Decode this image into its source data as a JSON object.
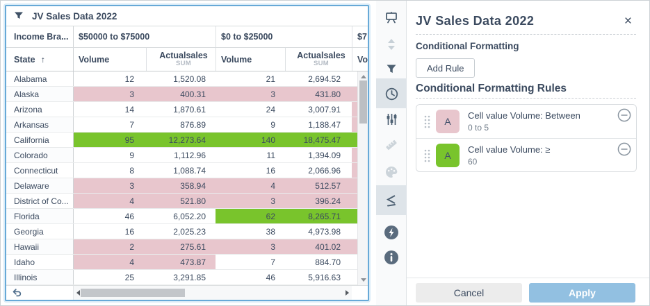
{
  "colors": {
    "green": "#79c42c",
    "pink": "#e8c6cd",
    "white": ""
  },
  "widget": {
    "title": "JV Sales Data 2022"
  },
  "table": {
    "corner_header": "Income Bra...",
    "brackets": [
      {
        "label": "$50000 to $75000"
      },
      {
        "label": "$0 to $25000"
      },
      {
        "label": "$7"
      }
    ],
    "state_header": "State",
    "sort_arrow": "↑",
    "volume_header": "Volume",
    "actual_header": "Actualsales",
    "sum_label": "SUM",
    "rows": [
      {
        "state": "Alabama",
        "cells": [
          {
            "v": "12",
            "c": "white"
          },
          {
            "v": "1,520.08",
            "c": "white"
          },
          {
            "v": "21",
            "c": "white"
          },
          {
            "v": "2,694.52",
            "c": "white"
          }
        ],
        "extra": "white"
      },
      {
        "state": "Alaska",
        "cells": [
          {
            "v": "3",
            "c": "pink"
          },
          {
            "v": "400.31",
            "c": "pink"
          },
          {
            "v": "3",
            "c": "pink"
          },
          {
            "v": "431.80",
            "c": "pink"
          }
        ],
        "extra": "pink"
      },
      {
        "state": "Arizona",
        "cells": [
          {
            "v": "14",
            "c": "white"
          },
          {
            "v": "1,870.61",
            "c": "white"
          },
          {
            "v": "24",
            "c": "white"
          },
          {
            "v": "3,007.91",
            "c": "white"
          }
        ],
        "extra": "pink"
      },
      {
        "state": "Arkansas",
        "cells": [
          {
            "v": "7",
            "c": "white"
          },
          {
            "v": "876.89",
            "c": "white"
          },
          {
            "v": "9",
            "c": "white"
          },
          {
            "v": "1,188.47",
            "c": "white"
          }
        ],
        "extra": "pink"
      },
      {
        "state": "California",
        "cells": [
          {
            "v": "95",
            "c": "green"
          },
          {
            "v": "12,273.64",
            "c": "green"
          },
          {
            "v": "140",
            "c": "green"
          },
          {
            "v": "18,475.47",
            "c": "green"
          }
        ],
        "extra": "green"
      },
      {
        "state": "Colorado",
        "cells": [
          {
            "v": "9",
            "c": "white"
          },
          {
            "v": "1,112.96",
            "c": "white"
          },
          {
            "v": "11",
            "c": "white"
          },
          {
            "v": "1,394.09",
            "c": "white"
          }
        ],
        "extra": "pink"
      },
      {
        "state": "Connecticut",
        "cells": [
          {
            "v": "8",
            "c": "white"
          },
          {
            "v": "1,088.74",
            "c": "white"
          },
          {
            "v": "16",
            "c": "white"
          },
          {
            "v": "2,066.96",
            "c": "white"
          }
        ],
        "extra": "pink"
      },
      {
        "state": "Delaware",
        "cells": [
          {
            "v": "3",
            "c": "pink"
          },
          {
            "v": "358.94",
            "c": "pink"
          },
          {
            "v": "4",
            "c": "pink"
          },
          {
            "v": "512.57",
            "c": "pink"
          }
        ],
        "extra": "pink"
      },
      {
        "state": "District of Co...",
        "cells": [
          {
            "v": "4",
            "c": "pink"
          },
          {
            "v": "521.80",
            "c": "pink"
          },
          {
            "v": "3",
            "c": "pink"
          },
          {
            "v": "396.24",
            "c": "pink"
          }
        ],
        "extra": "pink"
      },
      {
        "state": "Florida",
        "cells": [
          {
            "v": "46",
            "c": "white"
          },
          {
            "v": "6,052.20",
            "c": "white"
          },
          {
            "v": "62",
            "c": "green"
          },
          {
            "v": "8,265.71",
            "c": "green"
          }
        ],
        "extra": "green"
      },
      {
        "state": "Georgia",
        "cells": [
          {
            "v": "16",
            "c": "white"
          },
          {
            "v": "2,025.23",
            "c": "white"
          },
          {
            "v": "38",
            "c": "white"
          },
          {
            "v": "4,973.98",
            "c": "white"
          }
        ],
        "extra": "white"
      },
      {
        "state": "Hawaii",
        "cells": [
          {
            "v": "2",
            "c": "pink"
          },
          {
            "v": "275.61",
            "c": "pink"
          },
          {
            "v": "3",
            "c": "pink"
          },
          {
            "v": "401.02",
            "c": "pink"
          }
        ],
        "extra": "pink"
      },
      {
        "state": "Idaho",
        "cells": [
          {
            "v": "4",
            "c": "pink"
          },
          {
            "v": "473.87",
            "c": "pink"
          },
          {
            "v": "7",
            "c": "white"
          },
          {
            "v": "884.70",
            "c": "white"
          }
        ],
        "extra": "white"
      },
      {
        "state": "Illinois",
        "cells": [
          {
            "v": "25",
            "c": "white"
          },
          {
            "v": "3,291.85",
            "c": "white"
          },
          {
            "v": "46",
            "c": "white"
          },
          {
            "v": "5,916.63",
            "c": "white"
          }
        ],
        "extra": "white"
      }
    ]
  },
  "panel": {
    "title": "JV Sales Data 2022",
    "close_glyph": "×",
    "section_label": "Conditional Formatting",
    "add_rule_label": "Add Rule",
    "rules_header": "Conditional Formatting Rules",
    "rules": [
      {
        "letter": "A",
        "color": "pink",
        "title": "Cell value Volume: Between",
        "subtitle": "0 to 5"
      },
      {
        "letter": "A",
        "color": "green",
        "title": "Cell value Volume: ≥",
        "subtitle": "60"
      }
    ],
    "cancel_label": "Cancel",
    "apply_label": "Apply",
    "accent_apply": "#92c0e1"
  }
}
